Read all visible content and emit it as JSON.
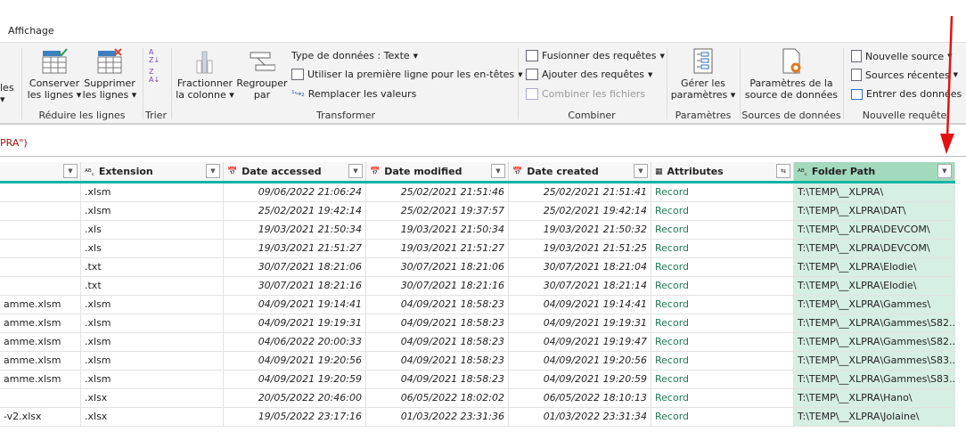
{
  "tabs": {
    "active": "Affichage"
  },
  "ribbon": {
    "partial_btn": {
      "line1": "les",
      "line2": "▾"
    },
    "keep_rows": {
      "line1": "Conserver",
      "line2": "les lignes ▾"
    },
    "remove_rows": {
      "line1": "Supprimer",
      "line2": "les lignes ▾"
    },
    "reduce_group": "Réduire les lignes",
    "sort_group": "Trier",
    "split_col": {
      "line1": "Fractionner",
      "line2": "la colonne ▾"
    },
    "group_by": {
      "line1": "Regrouper",
      "line2": "par"
    },
    "data_type": "Type de données : Texte",
    "first_row_headers": "Utiliser la première ligne pour les en-têtes",
    "replace_values": "Remplacer les valeurs",
    "transform_group": "Transformer",
    "merge_queries": "Fusionner des requêtes",
    "append_queries": "Ajouter des requêtes",
    "combine_files": "Combiner les fichiers",
    "combine_group": "Combiner",
    "manage_params": {
      "line1": "Gérer les",
      "line2": "paramètres ▾"
    },
    "params_group": "Paramètres",
    "source_settings": {
      "line1": "Paramètres de la",
      "line2": "source de données"
    },
    "sources_group": "Sources de données",
    "new_source": "Nouvelle source",
    "recent_sources": "Sources récentes",
    "enter_data": "Entrer des données",
    "new_query_group": "Nouvelle requête"
  },
  "formula": "PRA\")",
  "columns": [
    "",
    "Extension",
    "Date accessed",
    "Date modified",
    "Date created",
    "Attributes",
    "Folder Path"
  ],
  "rows": [
    [
      "",
      ".xlsm",
      "09/06/2022 21:06:24",
      "25/02/2021 21:51:46",
      "25/02/2021 21:51:41",
      "Record",
      "T:\\TEMP\\__XLPRA\\"
    ],
    [
      "",
      ".xlsm",
      "25/02/2021 19:42:14",
      "25/02/2021 19:37:57",
      "25/02/2021 19:42:14",
      "Record",
      "T:\\TEMP\\__XLPRA\\DAT\\"
    ],
    [
      "",
      ".xls",
      "19/03/2021 21:50:34",
      "19/03/2021 21:50:34",
      "19/03/2021 21:50:32",
      "Record",
      "T:\\TEMP\\__XLPRA\\DEVCOM\\"
    ],
    [
      "",
      ".xls",
      "19/03/2021 21:51:27",
      "19/03/2021 21:51:27",
      "19/03/2021 21:51:25",
      "Record",
      "T:\\TEMP\\__XLPRA\\DEVCOM\\"
    ],
    [
      "",
      ".txt",
      "30/07/2021 18:21:06",
      "30/07/2021 18:21:06",
      "30/07/2021 18:21:04",
      "Record",
      "T:\\TEMP\\__XLPRA\\Elodie\\"
    ],
    [
      "",
      ".txt",
      "30/07/2021 18:21:16",
      "30/07/2021 18:21:16",
      "30/07/2021 18:21:14",
      "Record",
      "T:\\TEMP\\__XLPRA\\Elodie\\"
    ],
    [
      "amme.xlsm",
      ".xlsm",
      "04/09/2021 19:14:41",
      "04/09/2021 18:58:23",
      "04/09/2021 19:14:41",
      "Record",
      "T:\\TEMP\\__XLPRA\\Gammes\\"
    ],
    [
      "amme.xlsm",
      ".xlsm",
      "04/09/2021 19:19:31",
      "04/09/2021 18:58:23",
      "04/09/2021 19:19:31",
      "Record",
      "T:\\TEMP\\__XLPRA\\Gammes\\S82..."
    ],
    [
      "amme.xlsm",
      ".xlsm",
      "04/06/2022 20:00:33",
      "04/09/2021 18:58:23",
      "04/09/2021 19:19:47",
      "Record",
      "T:\\TEMP\\__XLPRA\\Gammes\\S82..."
    ],
    [
      "amme.xlsm",
      ".xlsm",
      "04/09/2021 19:20:56",
      "04/09/2021 18:58:23",
      "04/09/2021 19:20:56",
      "Record",
      "T:\\TEMP\\__XLPRA\\Gammes\\S83..."
    ],
    [
      "amme.xlsm",
      ".xlsm",
      "04/09/2021 19:20:59",
      "04/09/2021 18:58:23",
      "04/09/2021 19:20:59",
      "Record",
      "T:\\TEMP\\__XLPRA\\Gammes\\S83..."
    ],
    [
      "",
      ".xlsx",
      "20/05/2022 20:46:00",
      "06/05/2022 18:02:02",
      "06/05/2022 18:10:13",
      "Record",
      "T:\\TEMP\\__XLPRA\\Hano\\"
    ],
    [
      "-v2.xlsx",
      ".xlsx",
      "19/05/2022 23:17:16",
      "01/03/2022 23:31:36",
      "01/03/2022 23:31:34",
      "Record",
      "T:\\TEMP\\__XLPRA\\Jolaine\\"
    ]
  ],
  "colors": {
    "teal": "#10b5a5",
    "selected": "#d6efe3",
    "arrow": "#e31212"
  }
}
